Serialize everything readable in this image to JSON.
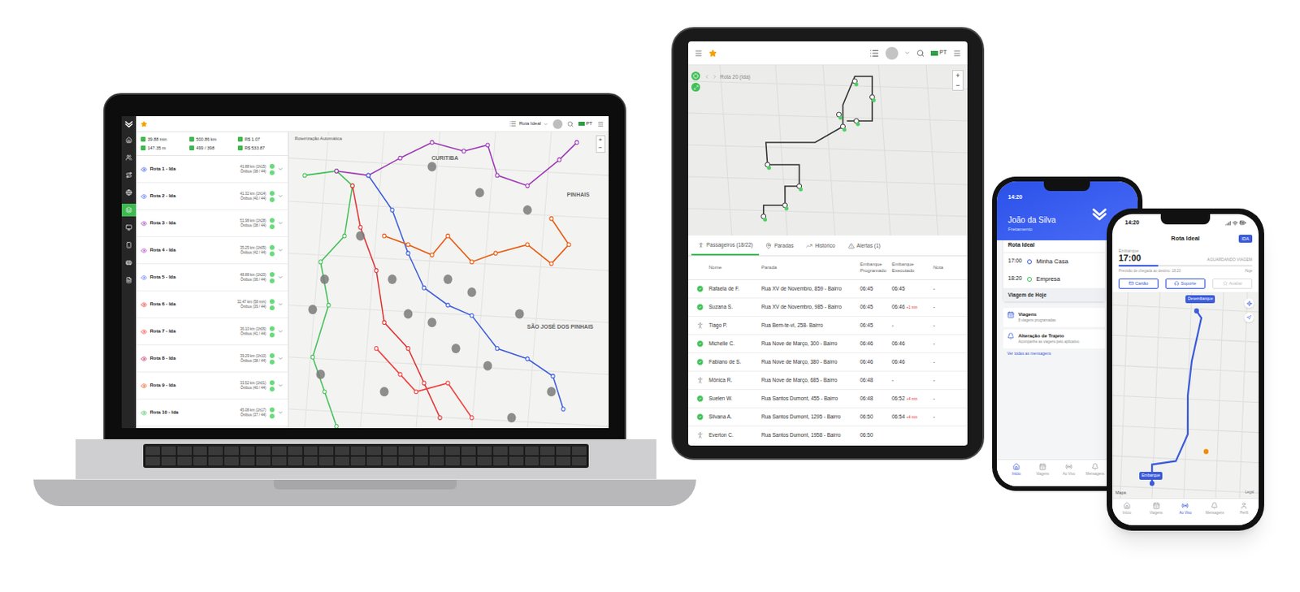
{
  "laptop": {
    "topbar": {
      "selector": "Rota Ideal",
      "language": "PT"
    },
    "nav": [
      {
        "selected": false
      },
      {
        "selected": false
      },
      {
        "selected": false
      },
      {
        "selected": false
      },
      {
        "selected": true
      },
      {
        "selected": false
      },
      {
        "selected": false
      },
      {
        "selected": false
      },
      {
        "selected": false
      }
    ],
    "stats": [
      "39.88 min",
      "500.86 km",
      "R$ 1.07",
      "147.35 m",
      "499 / 398",
      "R$ 533.87"
    ],
    "routes": [
      {
        "name": "Rota 1 - Ida",
        "distance": "41.88 km (1h15)",
        "vehicle": "Ônibus (38 / 44)",
        "color": "#3b5bdb"
      },
      {
        "name": "Rota 2 - Ida",
        "distance": "41.32 km (1h14)",
        "vehicle": "Ônibus (40 / 44)",
        "color": "#4c6ef5"
      },
      {
        "name": "Rota 3 - Ida",
        "distance": "51.98 km (1h28)",
        "vehicle": "Ônibus (38 / 44)",
        "color": "#9c36b5"
      },
      {
        "name": "Rota 4 - Ida",
        "distance": "35.25 km (1h05)",
        "vehicle": "Ônibus (42 / 44)",
        "color": "#ae3ec9"
      },
      {
        "name": "Rota 5 - Ida",
        "distance": "48.88 km (1h20)",
        "vehicle": "Ônibus (36 / 44)",
        "color": "#5c7cfa"
      },
      {
        "name": "Rota 6 - Ida",
        "distance": "32.47 km (58 min)",
        "vehicle": "Ônibus (39 / 44)",
        "color": "#e03131"
      },
      {
        "name": "Rota 7 - Ida",
        "distance": "36.10 km (1h06)",
        "vehicle": "Ônibus (41 / 44)",
        "color": "#f03e3e"
      },
      {
        "name": "Rota 8 - Ida",
        "distance": "39.29 km (1h10)",
        "vehicle": "Ônibus (38 / 44)",
        "color": "#c2255c"
      },
      {
        "name": "Rota 9 - Ida",
        "distance": "33.52 km (1h01)",
        "vehicle": "Ônibus (40 / 44)",
        "color": "#e8590c"
      },
      {
        "name": "Rota 10 - Ida",
        "distance": "45.08 km (1h17)",
        "vehicle": "Ônibus (37 / 44)",
        "color": "#40c057"
      }
    ],
    "map": {
      "title": "Roteirização Automática",
      "labels": [
        "CURITIBA",
        "PINHAIS",
        "SÃO JOSÉ DOS PINHAIS"
      ],
      "zoom": [
        "+",
        "−"
      ]
    }
  },
  "tablet": {
    "breadcrumb": "Rota 20 (Ida)",
    "language": "PT",
    "zoom": [
      "+",
      "−"
    ],
    "tabs": [
      {
        "label": "Passageiros (18/22)",
        "selected": true
      },
      {
        "label": "Paradas",
        "selected": false
      },
      {
        "label": "Histórico",
        "selected": false
      },
      {
        "label": "Alertas (1)",
        "selected": false
      }
    ],
    "columns": [
      "Nome",
      "Parada",
      "Embarque Programado",
      "Embarque Executado",
      "Nota"
    ],
    "rows": [
      {
        "kind": "boarded",
        "name": "Rafaela de F.",
        "stop": "Rua XV de Novembro, 859 - Bairro",
        "scheduled": "06:45",
        "executed": "06:45",
        "delay": "",
        "note": "-"
      },
      {
        "kind": "boarded",
        "name": "Suzana S.",
        "stop": "Rua XV de Novembro, 985 - Bairro",
        "scheduled": "06:45",
        "executed": "06:46",
        "delay": "+1 min",
        "note": "-"
      },
      {
        "kind": "walking",
        "name": "Tiago P.",
        "stop": "Rua Bem-te-vi, 258- Bairro",
        "scheduled": "06:45",
        "executed": "-",
        "delay": "",
        "note": "-"
      },
      {
        "kind": "boarded",
        "name": "Michelle C.",
        "stop": "Rua Nove de Março, 300 - Bairro",
        "scheduled": "06:46",
        "executed": "06:46",
        "delay": "",
        "note": "-"
      },
      {
        "kind": "boarded",
        "name": "Fabiano de S.",
        "stop": "Rua Nove de Março, 380 - Bairro",
        "scheduled": "06:46",
        "executed": "06:46",
        "delay": "",
        "note": "-"
      },
      {
        "kind": "walking",
        "name": "Mônica R.",
        "stop": "Rua Nove de Março, 685 - Bairro",
        "scheduled": "06:48",
        "executed": "-",
        "delay": "",
        "note": "-"
      },
      {
        "kind": "boarded",
        "name": "Suelen W.",
        "stop": "Rua Santos Dumont, 455 - Bairro",
        "scheduled": "06:48",
        "executed": "06:52",
        "delay": "+4 min",
        "note": "-"
      },
      {
        "kind": "boarded",
        "name": "Silvana A.",
        "stop": "Rua Santos Dumont, 1295 - Bairro",
        "scheduled": "06:50",
        "executed": "06:54",
        "delay": "+4 min",
        "note": "-"
      },
      {
        "kind": "walking",
        "name": "Everton C.",
        "stop": "Rua Santos Dumont, 1958 - Bairro",
        "scheduled": "06:50",
        "executed": "",
        "delay": "",
        "note": ""
      }
    ]
  },
  "phone_home": {
    "time": "14:20",
    "user": "João da Silva",
    "profile": "Fretamento",
    "card_title": "Rota Ideal",
    "stops": [
      {
        "time": "17:00",
        "place": "Minha Casa"
      },
      {
        "time": "18:20",
        "place": "Empresa"
      }
    ],
    "today": "Viagem de Hoje",
    "items": [
      {
        "title": "Viagens",
        "subtitle": "8 viagens programadas"
      },
      {
        "title": "Alteração de Trajeto",
        "subtitle": "Acompanhe as viagens pelo aplicativo"
      }
    ],
    "link": "Ver todas as mensagens",
    "tabs": [
      {
        "label": "Início",
        "selected": true
      },
      {
        "label": "Viagens",
        "selected": false
      },
      {
        "label": "Ao Vivo",
        "selected": false
      },
      {
        "label": "Mensagens",
        "selected": false
      }
    ]
  },
  "phone_live": {
    "time": "14:20",
    "title": "Rota Ideal",
    "badge": "IDA",
    "boarding_label": "Embarque",
    "boarding_time": "17:00",
    "status": "AGUARDANDO VIAGEM",
    "level": 0.3,
    "forecast": "Previsão de chegada ao destino: 18:20",
    "day": "Hoje",
    "actions": [
      {
        "label": "Cartão",
        "disabled": false
      },
      {
        "label": "Suporte",
        "disabled": false
      },
      {
        "label": "Avaliar",
        "disabled": true
      }
    ],
    "map": {
      "pickup": "Embarque",
      "dropoff": "Desembarque",
      "attribution": "Maps",
      "legal": "Legal"
    },
    "tabs": [
      {
        "label": "Início",
        "selected": false
      },
      {
        "label": "Viagens",
        "selected": false
      },
      {
        "label": "Ao Vivo",
        "selected": true
      },
      {
        "label": "Mensagens",
        "selected": false
      },
      {
        "label": "Perfil",
        "selected": false
      }
    ]
  }
}
